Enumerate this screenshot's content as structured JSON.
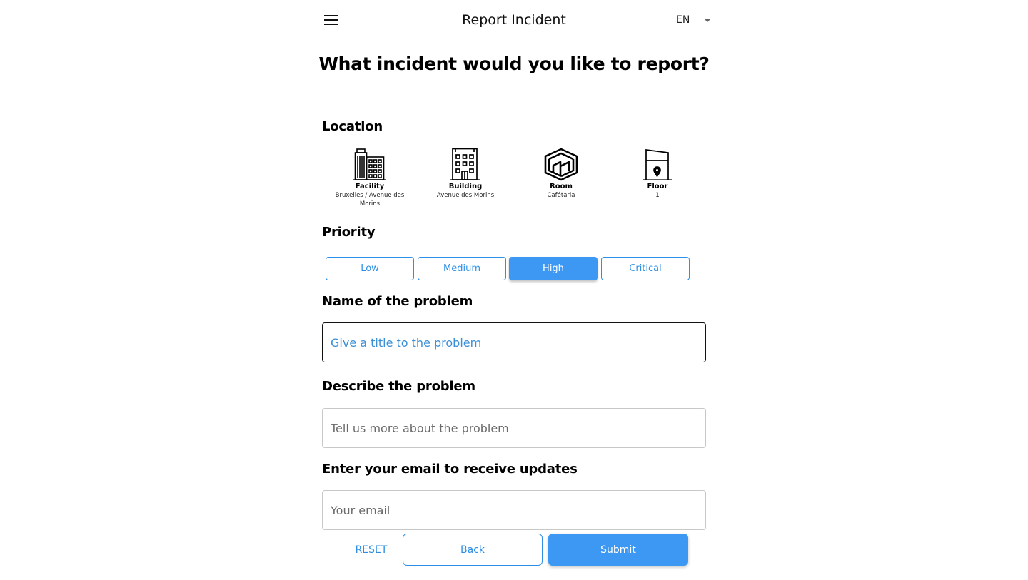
{
  "header": {
    "title": "Report Incident",
    "menu_icon": "hamburger-menu-icon",
    "language": {
      "selected": "EN",
      "icon": "caret-down-icon"
    }
  },
  "heading": "What incident would you like to report?",
  "location": {
    "title": "Location",
    "items": [
      {
        "label": "Facility",
        "value": "Bruxelles / Avenue des Morins",
        "icon": "facility-icon"
      },
      {
        "label": "Building",
        "value": "Avenue des Morins",
        "icon": "building-icon"
      },
      {
        "label": "Room",
        "value": "Cafétaria",
        "icon": "room-icon"
      },
      {
        "label": "Floor",
        "value": "1",
        "icon": "floor-icon"
      }
    ]
  },
  "priority": {
    "title": "Priority",
    "options": [
      "Low",
      "Medium",
      "High",
      "Critical"
    ],
    "selected": "High"
  },
  "problem_name": {
    "title": "Name of the problem",
    "value": "",
    "placeholder": "Give a title to the problem"
  },
  "problem_description": {
    "title": "Describe the problem",
    "value": "",
    "placeholder": "Tell us more about the problem"
  },
  "email": {
    "title": "Enter your email to receive updates",
    "value": "",
    "placeholder": "Your email"
  },
  "actions": {
    "reset": "RESET",
    "back": "Back",
    "submit": "Submit"
  },
  "colors": {
    "accent": "#3d98f3",
    "accent_text": "#2d8fe6"
  }
}
